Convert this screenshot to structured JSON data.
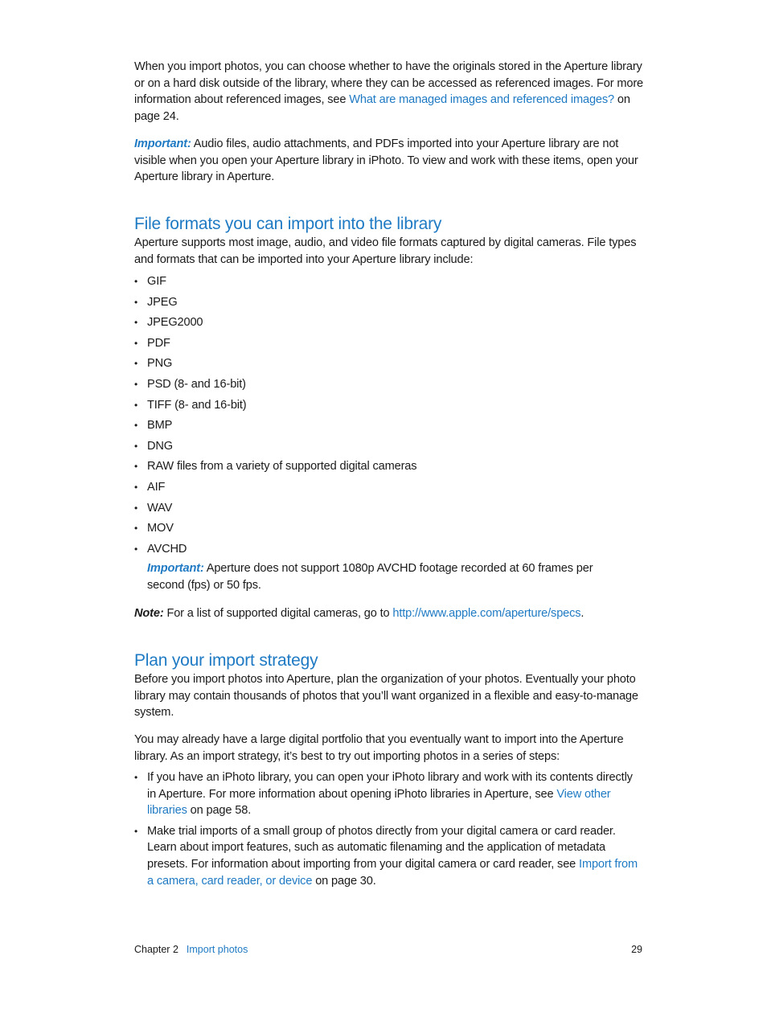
{
  "intro": {
    "text_before_link": "When you import photos, you can choose whether to have the originals stored in the Aperture library or on a hard disk outside of the library, where they can be accessed as referenced images. For more information about referenced images, see ",
    "link": "What are managed images and referenced images?",
    "text_after_link": " on page 24."
  },
  "important_1": {
    "label": "Important:",
    "text": " Audio files, audio attachments, and PDFs imported into your Aperture library are not visible when you open your Aperture library in iPhoto. To view and work with these items, open your Aperture library in Aperture."
  },
  "section_formats": {
    "heading": "File formats you can import into the library",
    "intro": "Aperture supports most image, audio, and video file formats captured by digital cameras. File types and formats that can be imported into your Aperture library include:",
    "bullet": "•",
    "formats": [
      "GIF",
      "JPEG",
      "JPEG2000",
      "PDF",
      "PNG",
      "PSD (8- and 16-bit)",
      "TIFF (8- and 16-bit)",
      "BMP",
      "DNG",
      "RAW files from a variety of supported digital cameras",
      "AIF",
      "WAV",
      "MOV",
      "AVCHD"
    ],
    "important": {
      "label": "Important:",
      "text": " Aperture does not support 1080p AVCHD footage recorded at 60 frames per second (fps) or 50 fps."
    },
    "note": {
      "label": "Note:",
      "text": " For a list of supported digital cameras, go to ",
      "link": "http://www.apple.com/aperture/specs",
      "text_after": "."
    }
  },
  "section_strategy": {
    "heading": "Plan your import strategy",
    "para1": "Before you import photos into Aperture, plan the organization of your photos. Eventually your photo library may contain thousands of photos that you’ll want organized in a flexible and easy-to-manage system.",
    "para2": "You may already have a large digital portfolio that you eventually want to import into the Aperture library. As an import strategy, it’s best to try out importing photos in a series of steps:",
    "steps": [
      {
        "text": "If you have an iPhoto library, you can open your iPhoto library and work with its contents directly in Aperture. For more information about opening iPhoto libraries in Aperture, see ",
        "link": "View other libraries",
        "after": " on page 58."
      },
      {
        "text": "Make trial imports of a small group of photos directly from your digital camera or card reader. Learn about import features, such as automatic filenaming and the application of metadata presets. For information about importing from your digital camera or card reader, see ",
        "link": "Import from a camera, card reader, or device",
        "after": " on page 30."
      }
    ]
  },
  "footer": {
    "chapter": "Chapter 2",
    "chapter_title": "Import photos",
    "page_number": "29"
  },
  "colors": {
    "accent": "#1f7ac4",
    "text": "#1a1a1a",
    "background": "#ffffff"
  }
}
